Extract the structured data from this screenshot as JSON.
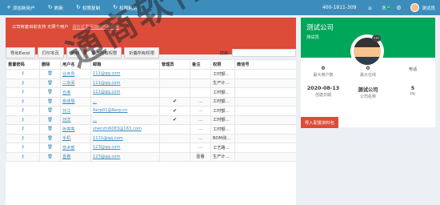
{
  "topbar": {
    "add_user": "添加新用户",
    "refresh": "刷新",
    "copy_perm": "权限复制",
    "paste_perm": "权限粘贴",
    "phone": "400-1811-309",
    "badge": "10",
    "username": "测试员",
    "accent_color": "#3c8dbc"
  },
  "alert": {
    "text": "公司帐套目前支持 无限个用户",
    "link": "请在这里添加用户及权限",
    "color": "#dd4b39"
  },
  "toolbar": {
    "export": "导出Excel",
    "print": "打印本页",
    "refresh": "刷新",
    "expand": "展开所有权限",
    "collapse": "折叠所有权限",
    "search_label": "搜索:"
  },
  "table": {
    "headers": [
      "重置密码",
      "删除",
      "用户名",
      "邮箱",
      "管理员",
      "备注",
      "权限",
      "微信号"
    ],
    "rows": [
      {
        "name": "业务员",
        "email": "111@qq.com",
        "admin": "",
        "note": "",
        "perm": "工时额定..."
      },
      {
        "name": "二车间",
        "email": "111@qq.com",
        "admin": "",
        "note": "",
        "perm": "生产计划..."
      },
      {
        "name": "仓库",
        "email": "111@qq.com",
        "admin": "",
        "note": "",
        "perm": "工时额定..."
      },
      {
        "name": "俞佳慧",
        "email": "...",
        "admin": "✔",
        "note": "...",
        "perm": "工时额定..."
      },
      {
        "name": "刘江",
        "email": "6erp01@6erp.cn",
        "admin": "✔",
        "note": "...",
        "perm": "工时额定..."
      },
      {
        "name": "刘洋",
        "email": "...",
        "admin": "✔",
        "note": "...",
        "perm": "工时额定..."
      },
      {
        "name": "张亮亮",
        "email": "shenzhi6083@163.com",
        "admin": "",
        "note": "...",
        "perm": "工时额定..."
      },
      {
        "name": "手机",
        "email": "1111@qq.com",
        "admin": "",
        "note": "...",
        "perm": "BOM测..."
      },
      {
        "name": "技术部",
        "email": "123@qq.com",
        "admin": "",
        "note": "...",
        "perm": "工艺路线..."
      },
      {
        "name": "壹看",
        "email": "123@qq.com",
        "admin": "",
        "note": "壹看",
        "perm": "生产计划..."
      }
    ]
  },
  "company": {
    "title": "测试公司",
    "subtitle": "测试员",
    "stats_row1": [
      {
        "value": "0",
        "label": "最大用户数"
      },
      {
        "value": "0",
        "label": "最大在线"
      },
      {
        "value": "",
        "label": "电话"
      }
    ],
    "stats_row2": [
      {
        "value": "2020-08-13",
        "label": "创建日期"
      },
      {
        "value": "测试公司",
        "label": "公司名称"
      },
      {
        "value": "5",
        "label": "PK"
      }
    ],
    "color": "#00a65a"
  },
  "import_button": "导入配置资料包",
  "watermark": "通商软件"
}
